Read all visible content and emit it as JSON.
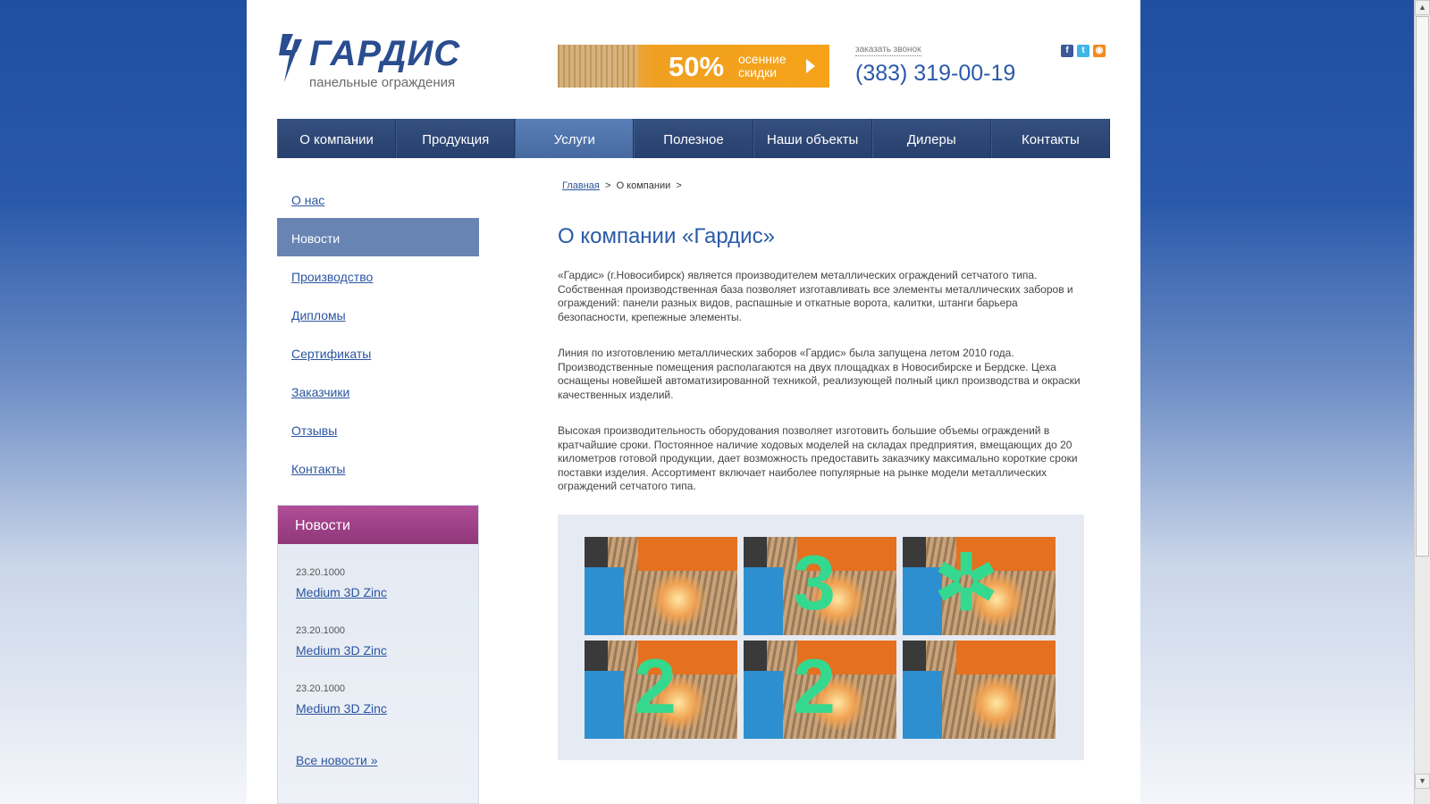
{
  "header": {
    "logo_text": "ГАРДИС",
    "logo_subtitle": "панельные ограждения",
    "promo": {
      "percent": "50%",
      "line1": "осенние",
      "line2": "скидки"
    },
    "callback_label": "заказать звонок",
    "phone": "(383) 319-00-19",
    "social": [
      "f",
      "t",
      "rss"
    ]
  },
  "nav": {
    "items": [
      "О компании",
      "Продукция",
      "Услуги",
      "Полезное",
      "Наши объекты",
      "Дилеры",
      "Контакты"
    ],
    "active_index": 2
  },
  "sidebar": {
    "items": [
      "О нас",
      "Новости",
      "Производство",
      "Дипломы",
      "Сертификаты",
      "Заказчики",
      "Отзывы",
      "Контакты"
    ],
    "active_index": 1
  },
  "news": {
    "title": "Новости",
    "items": [
      {
        "date": "23.20.1000",
        "title": "Medium 3D Zinc"
      },
      {
        "date": "23.20.1000",
        "title": "Medium 3D Zinc"
      },
      {
        "date": "23.20.1000",
        "title": "Medium 3D Zinc"
      }
    ],
    "all_label": "Все новости »"
  },
  "breadcrumb": {
    "home": "Главная",
    "sep": ">",
    "current": "О компании"
  },
  "content": {
    "title": "О компании «Гардис»",
    "paragraphs": [
      "«Гардис» (г.Новосибирск) является производителем металлических ограждений сетчатого типа. Собственная производственная база позволяет изготавливать все элементы металлических заборов и ограждений: панели разных видов, распашные и откатные ворота, калитки, штанги барьера безопасности, крепежные элементы.",
      "Линия по изготовлению металлических заборов «Гардис» была запущена летом 2010 года. Производственные помещения располагаются на двух площадках в Новосибирске и Бердске. Цеха оснащены новейшей автоматизированной техникой, реализующей полный цикл производства и окраски качественных изделий.",
      "Высокая производительность оборудования позволяет изготовить большие объемы ограждений в кратчайшие сроки. Постоянное наличие ходовых моделей на складах предприятия, вмещающих до 20 километров готовой продукции, дает возможность предоставить заказчику максимально короткие сроки поставки изделия. Ассортимент включает наиболее популярные на рынке модели металлических ограждений сетчатого типа."
    ]
  },
  "gallery": {
    "marks": [
      "",
      "3",
      "✲",
      "2",
      "2",
      ""
    ],
    "mark_color": "#34d98f"
  }
}
